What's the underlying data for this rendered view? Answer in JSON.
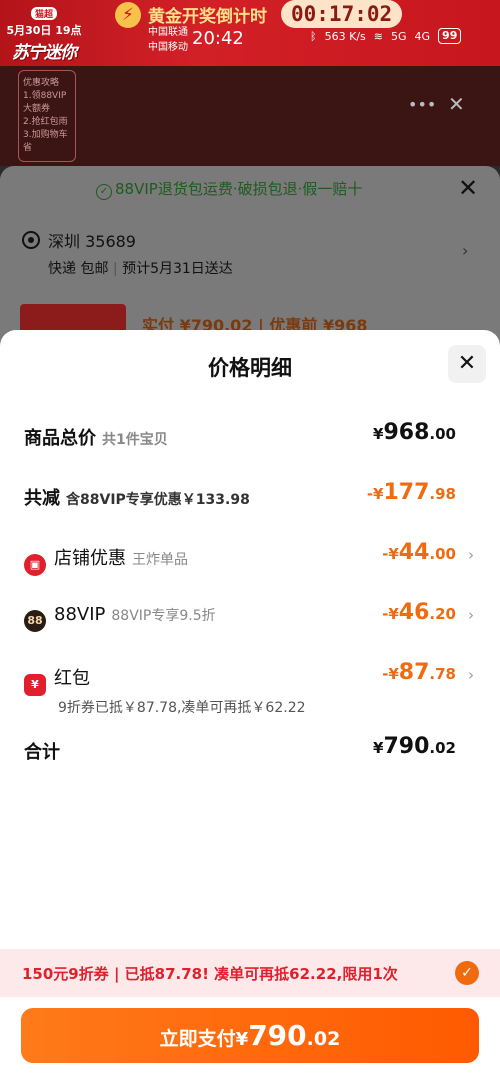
{
  "status_bar": {
    "promo_badge_top": "猫超",
    "promo_date": "5月30日 19点",
    "promo_logo": "苏宁迷你",
    "countdown_icon": "lightning-icon",
    "countdown_label": "黄金开奖倒计时",
    "countdown_time": "00:17:02",
    "carrier1": "中国联通",
    "carrier2": "中国移动",
    "time": "20:42",
    "net_speed": "563 K/s",
    "signal1": "5G",
    "signal2": "4G",
    "battery": "99"
  },
  "background_page": {
    "side_panel_title": "优惠攻略",
    "side_lines": [
      "1.领88VIP大额券",
      "2.抢红包雨",
      "3.加购物车省"
    ]
  },
  "order_sheet": {
    "guarantee": "88VIP退货包运费·破损包退·假一赔十",
    "address": "深圳 35689",
    "shipping": "快递 包邮",
    "delivery": "预计5月31日送达",
    "price_line": "实付 ¥790.02 | 优惠前 ¥968"
  },
  "price_detail": {
    "title": "价格明细",
    "total": {
      "label": "商品总价",
      "sub": "共1件宝贝",
      "cur": "¥",
      "int": "968",
      "dec": ".00"
    },
    "discount": {
      "label": "共减",
      "sub": "含88VIP专享优惠￥133.98",
      "cur": "-¥",
      "int": "177",
      "dec": ".98"
    },
    "shop": {
      "label": "店铺优惠",
      "sub": "王炸单品",
      "cur": "-¥",
      "int": "44",
      "dec": ".00",
      "icon": "shop-icon",
      "color": "#e0202d"
    },
    "vip": {
      "label": "88VIP",
      "sub": "88VIP专享9.5折",
      "cur": "-¥",
      "int": "46",
      "dec": ".20",
      "icon": "88vip-icon",
      "icon_text": "88",
      "color": "#2a1c12"
    },
    "redpack": {
      "label": "红包",
      "note": "9折券已抵￥87.78,凑单可再抵￥62.22",
      "cur": "-¥",
      "int": "87",
      "dec": ".78",
      "icon": "red-envelope-icon",
      "color": "#e0202d"
    },
    "sum": {
      "label": "合计",
      "cur": "¥",
      "int": "790",
      "dec": ".02"
    }
  },
  "coupon": {
    "text": "150元9折券 | 已抵87.78! 凑单可再抵62.22,限用1次",
    "check_icon": "check-circle-icon"
  },
  "pay_button": {
    "label": "立即支付",
    "cur": "¥",
    "int": "790",
    "dec": ".02"
  },
  "colors": {
    "accent": "#f06a10",
    "brand_red": "#e0202d",
    "pay_button": "#ff6a0a"
  }
}
